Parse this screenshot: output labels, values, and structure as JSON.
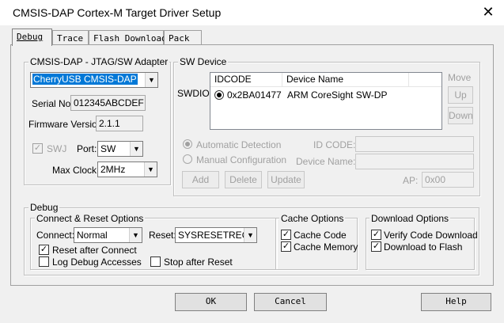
{
  "window": {
    "title": "CMSIS-DAP Cortex-M Target Driver Setup",
    "close_glyph": "✕"
  },
  "tabs": [
    {
      "label": "Debug",
      "active": true
    },
    {
      "label": "Trace",
      "active": false
    },
    {
      "label": "Flash Download",
      "active": false
    },
    {
      "label": "Pack",
      "active": false
    }
  ],
  "adapter": {
    "group_label": "CMSIS-DAP - JTAG/SW Adapter",
    "device_value": "CherryUSB CMSIS-DAP",
    "serial_label": "Serial No:",
    "serial_value": "012345ABCDEF",
    "firmware_label": "Firmware Version:",
    "firmware_value": "2.1.1",
    "swj_label": "SWJ",
    "swj_checked": true,
    "port_label": "Port:",
    "port_value": "SW",
    "maxclock_label": "Max Clock:",
    "maxclock_value": "2MHz"
  },
  "sw_device": {
    "group_label": "SW Device",
    "swdio_label": "SWDIO",
    "columns": [
      "IDCODE",
      "Device Name"
    ],
    "rows": [
      {
        "idcode": "0x2BA01477",
        "device_name": "ARM CoreSight SW-DP",
        "selected": true
      }
    ],
    "move_label": "Move",
    "up_label": "Up",
    "down_label": "Down",
    "automatic_detection": "Automatic Detection",
    "manual_configuration": "Manual Configuration",
    "id_code_label": "ID CODE:",
    "device_name_label": "Device Name:",
    "add_label": "Add",
    "delete_label": "Delete",
    "update_label": "Update",
    "ap_label": "AP:",
    "ap_value": "0x00"
  },
  "debug": {
    "group_label": "Debug",
    "connect_reset": {
      "group_label": "Connect & Reset Options",
      "connect_label": "Connect:",
      "connect_value": "Normal",
      "reset_label": "Reset:",
      "reset_value": "SYSRESETREQ",
      "reset_after_connect": "Reset after Connect",
      "reset_after_connect_checked": true,
      "log_debug_accesses": "Log Debug Accesses",
      "log_debug_accesses_checked": false,
      "stop_after_reset": "Stop after Reset",
      "stop_after_reset_checked": false
    },
    "cache": {
      "group_label": "Cache Options",
      "cache_code": "Cache Code",
      "cache_code_checked": true,
      "cache_memory": "Cache Memory",
      "cache_memory_checked": true
    },
    "download": {
      "group_label": "Download Options",
      "verify_code_download": "Verify Code Download",
      "verify_code_download_checked": true,
      "download_to_flash": "Download to Flash",
      "download_to_flash_checked": true
    }
  },
  "buttons": {
    "ok": "OK",
    "cancel": "Cancel",
    "help": "Help"
  },
  "colors": {
    "selection": "#0078d7",
    "window_bg": "#f0f0f0"
  }
}
